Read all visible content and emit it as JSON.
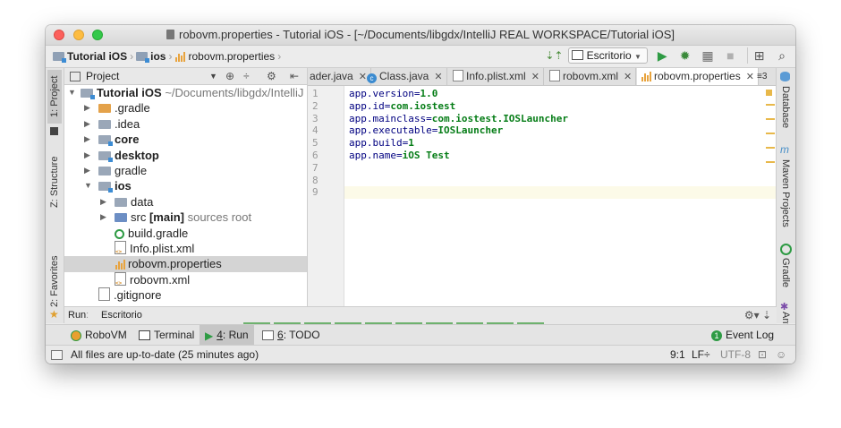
{
  "window": {
    "title": "robovm.properties - Tutorial iOS - [~/Documents/libgdx/IntelliJ REAL WORKSPACE/Tutorial iOS]"
  },
  "navbar": {
    "breadcrumbs": [
      "Tutorial iOS",
      "ios",
      "robovm.properties"
    ],
    "run_config": "Escritorio"
  },
  "left_stripe": {
    "project_tab": "1: Project",
    "structure_tab": "Z: Structure",
    "favorites_tab": "2: Favorites"
  },
  "right_stripe": {
    "database_tab": "Database",
    "maven_tab": "Maven Projects",
    "gradle_tab": "Gradle",
    "ant_tab": "Ant"
  },
  "project_panel": {
    "header": "Project",
    "tree": [
      {
        "name": "Tutorial iOS",
        "extra": "~/Documents/libgdx/IntelliJ"
      },
      {
        "name": ".gradle"
      },
      {
        "name": ".idea"
      },
      {
        "name": "core"
      },
      {
        "name": "desktop"
      },
      {
        "name": "gradle"
      },
      {
        "name": "ios"
      },
      {
        "name": "data"
      },
      {
        "name": "src",
        "tag": "[main]",
        "extra": "sources root"
      },
      {
        "name": "build.gradle"
      },
      {
        "name": "Info.plist.xml"
      },
      {
        "name": "robovm.properties"
      },
      {
        "name": "robovm.xml"
      },
      {
        "name": ".gitignore"
      }
    ]
  },
  "editor": {
    "tabs": [
      {
        "label": "ader.java"
      },
      {
        "label": "Class.java"
      },
      {
        "label": "Info.plist.xml"
      },
      {
        "label": "robovm.xml"
      },
      {
        "label": "robovm.properties"
      }
    ],
    "overflow": "≡3",
    "line_numbers": [
      "1",
      "2",
      "3",
      "4",
      "5",
      "6",
      "7",
      "8",
      "9"
    ],
    "lines": [
      {
        "key": "app.version=",
        "value": "1.0"
      },
      {
        "key": "app.id=",
        "value": "com.iostest"
      },
      {
        "key": "app.mainclass=",
        "value": "com.iostest.IOSLauncher"
      },
      {
        "key": "app.executable=",
        "value": "IOSLauncher"
      },
      {
        "key": "app.build=",
        "value": "1"
      },
      {
        "key": "app.name=",
        "value": "iOS Test"
      },
      {
        "key": "",
        "value": ""
      },
      {
        "key": "",
        "value": ""
      },
      {
        "key": "",
        "value": ""
      }
    ]
  },
  "run_panel": {
    "label": "Run",
    "config": "Escritorio"
  },
  "tool_windows": {
    "robovm": "RoboVM",
    "terminal": "Terminal",
    "run_num": "4",
    "run": ": Run",
    "todo_num": "6",
    "todo": ": TODO",
    "event_log_count": "1",
    "event_log": "Event Log"
  },
  "status": {
    "message": "All files are up-to-date (25 minutes ago)",
    "position": "9:1",
    "line_sep": "LF÷",
    "encoding": "UTF-8"
  },
  "colors": {
    "property_value": "#067d17",
    "property_key": "#000080",
    "current_line": "#fcfae8",
    "run_green": "#2e9b44"
  }
}
